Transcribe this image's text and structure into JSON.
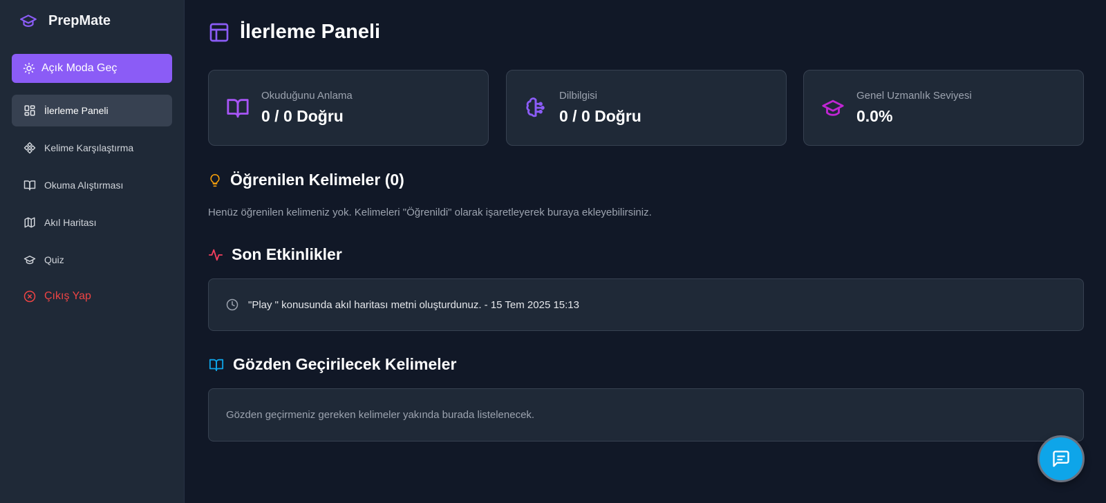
{
  "app": {
    "name": "PrepMate"
  },
  "colors": {
    "accent": "#8b5cf6",
    "background": "#111827",
    "sidebar": "#1f2937",
    "danger": "#ef4444",
    "chat": "#0ea5e9"
  },
  "sidebar": {
    "theme_toggle": {
      "label": "Açık Moda Geç",
      "icon": "sun-icon"
    },
    "items": [
      {
        "label": "İlerleme Paneli",
        "icon": "grid-icon",
        "active": true
      },
      {
        "label": "Kelime Karşılaştırma",
        "icon": "diamond-icon"
      },
      {
        "label": "Okuma Alıştırması",
        "icon": "book-open-icon"
      },
      {
        "label": "Akıl Haritası",
        "icon": "map-icon"
      },
      {
        "label": "Quiz",
        "icon": "graduation-cap-icon"
      }
    ],
    "logout": {
      "label": "Çıkış Yap",
      "icon": "x-circle-icon"
    }
  },
  "main": {
    "title": "İlerleme Paneli",
    "stats": [
      {
        "label": "Okuduğunu Anlama",
        "value": "0 / 0 Doğru",
        "icon": "book-open-icon"
      },
      {
        "label": "Dilbilgisi",
        "value": "0 / 0 Doğru",
        "icon": "brain-circuit-icon"
      },
      {
        "label": "Genel Uzmanlık Seviyesi",
        "value": "0.0%",
        "icon": "graduation-cap-icon"
      }
    ],
    "learned_words": {
      "title": "Öğrenilen Kelimeler (0)",
      "empty_text": "Henüz öğrenilen kelimeniz yok. Kelimeleri \"Öğrenildi\" olarak işaretleyerek buraya ekleyebilirsiniz."
    },
    "recent_activities": {
      "title": "Son Etkinlikler",
      "items": [
        {
          "text": "\"Play \" konusunda akıl haritası metni oluşturdunuz. - 15 Tem 2025 15:13"
        }
      ]
    },
    "review_words": {
      "title": "Gözden Geçirilecek Kelimeler",
      "empty_text": "Gözden geçirmeniz gereken kelimeler yakında burada listelenecek."
    }
  },
  "chat_button": {
    "icon": "message-icon"
  }
}
